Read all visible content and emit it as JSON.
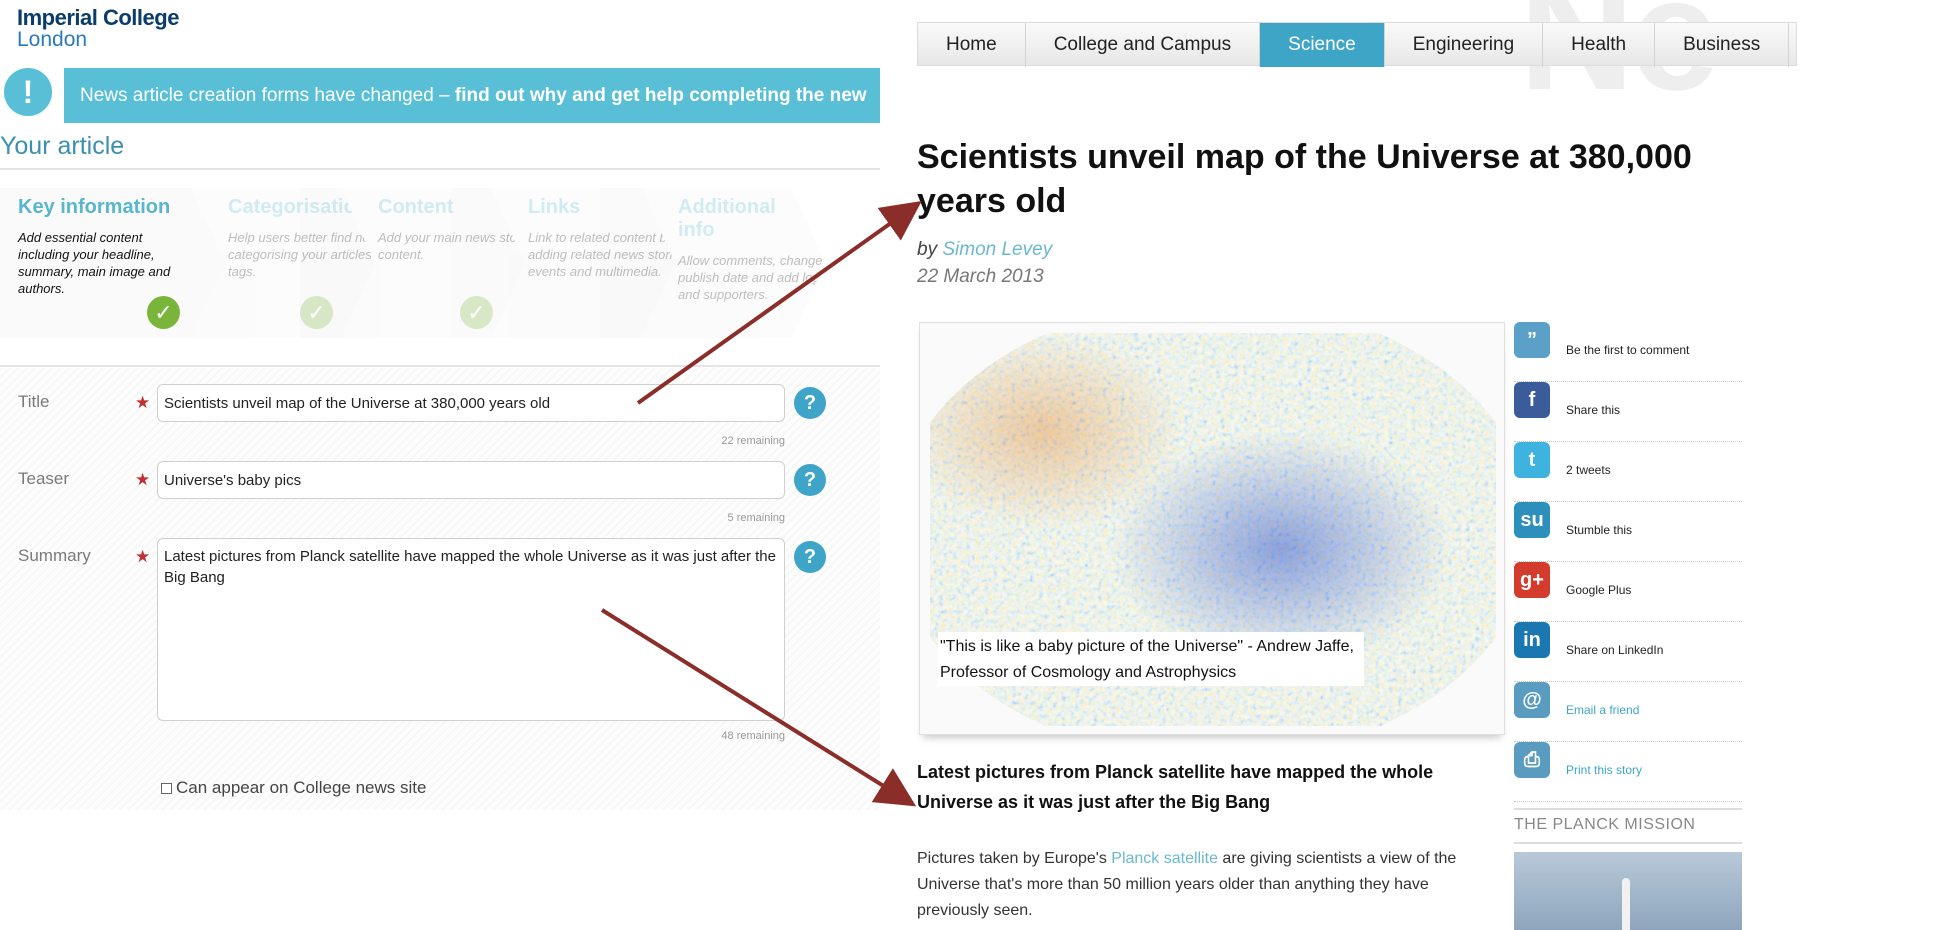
{
  "form": {
    "logo": {
      "line1": "Imperial College",
      "line2": "London"
    },
    "notice": {
      "icon": "!",
      "text": "News article creation forms have changed – ",
      "link": "find out why and get help completing the new"
    },
    "section_title": "Your article",
    "steps": [
      {
        "title": "Key information",
        "desc": "Add essential content including your headline, summary, main image and authors.",
        "check": "✓"
      },
      {
        "title": "Categorisation",
        "desc": "Help users better find news by categorising your articles and tags.",
        "check": "✓"
      },
      {
        "title": "Content",
        "desc": "Add your main news story content.",
        "check": "✓"
      },
      {
        "title": "Links",
        "desc": "Link to related content by adding related news stories, events and multimedia.",
        "check": "✓"
      },
      {
        "title": "Additional info",
        "desc": "Allow comments, change the publish date and add logos and supporters.",
        "check": "✓"
      }
    ],
    "fields": {
      "title": {
        "label": "Title",
        "value": "Scientists unveil map of the Universe at 380,000 years old",
        "remaining": "22 remaining"
      },
      "teaser": {
        "label": "Teaser",
        "value": "Universe's baby pics",
        "remaining": "5 remaining"
      },
      "summary": {
        "label": "Summary",
        "value": "Latest pictures from Planck satellite have mapped the whole Universe as it was just after the Big Bang",
        "remaining": "48 remaining"
      }
    },
    "required_mark": "★",
    "help_icon": "?",
    "checkbox_label": "Can appear on College news site"
  },
  "article": {
    "background_text": "Ne",
    "nav": [
      {
        "label": "Home",
        "active": false
      },
      {
        "label": "College and Campus",
        "active": false
      },
      {
        "label": "Science",
        "active": true
      },
      {
        "label": "Engineering",
        "active": false
      },
      {
        "label": "Health",
        "active": false
      },
      {
        "label": "Business",
        "active": false
      }
    ],
    "headline": "Scientists unveil map of the Universe at 380,000 years old",
    "by": "by",
    "author": "Simon Levey",
    "date": "22 March 2013",
    "caption_line1": "\"This is like a baby picture of the Universe\" - Andrew Jaffe,",
    "caption_line2": "Professor of Cosmology and Astrophysics",
    "summary": "Latest pictures from Planck satellite have mapped the whole Universe as it was just after the Big Bang",
    "body_before": "Pictures taken by Europe's ",
    "body_link": "Planck satellite",
    "body_after": " are giving scientists a view of the Universe that's more than 50 million years older than anything they have previously seen.",
    "share": [
      {
        "icon": "comment-icon",
        "glyph": "”",
        "color": "#5aa0c8",
        "text": "Be the first to comment",
        "link": false
      },
      {
        "icon": "facebook-icon",
        "glyph": "f",
        "color": "#3b5c9a",
        "text": "Share this",
        "link": false
      },
      {
        "icon": "twitter-icon",
        "glyph": "t",
        "color": "#3fb3e0",
        "text": "2 tweets",
        "link": false
      },
      {
        "icon": "stumbleupon-icon",
        "glyph": "su",
        "color": "#2d8fbc",
        "text": "Stumble this",
        "link": false
      },
      {
        "icon": "google-plus-icon",
        "glyph": "g+",
        "color": "#d33b2c",
        "text": "Google Plus",
        "link": false
      },
      {
        "icon": "linkedin-icon",
        "glyph": "in",
        "color": "#1a77b1",
        "text": "Share on LinkedIn",
        "link": false
      },
      {
        "icon": "email-icon",
        "glyph": "@",
        "color": "#5a9bc0",
        "text": "Email a friend",
        "link": true
      },
      {
        "icon": "print-icon",
        "glyph": "⎙",
        "color": "#5a9bc0",
        "text": "Print this story",
        "link": true
      }
    ],
    "mission_title": "THE PLANCK MISSION"
  },
  "colors": {
    "accent": "#3fa5c6",
    "notice": "#58bfd6",
    "arrow": "#8b2e2a",
    "check": "#79b43b"
  }
}
